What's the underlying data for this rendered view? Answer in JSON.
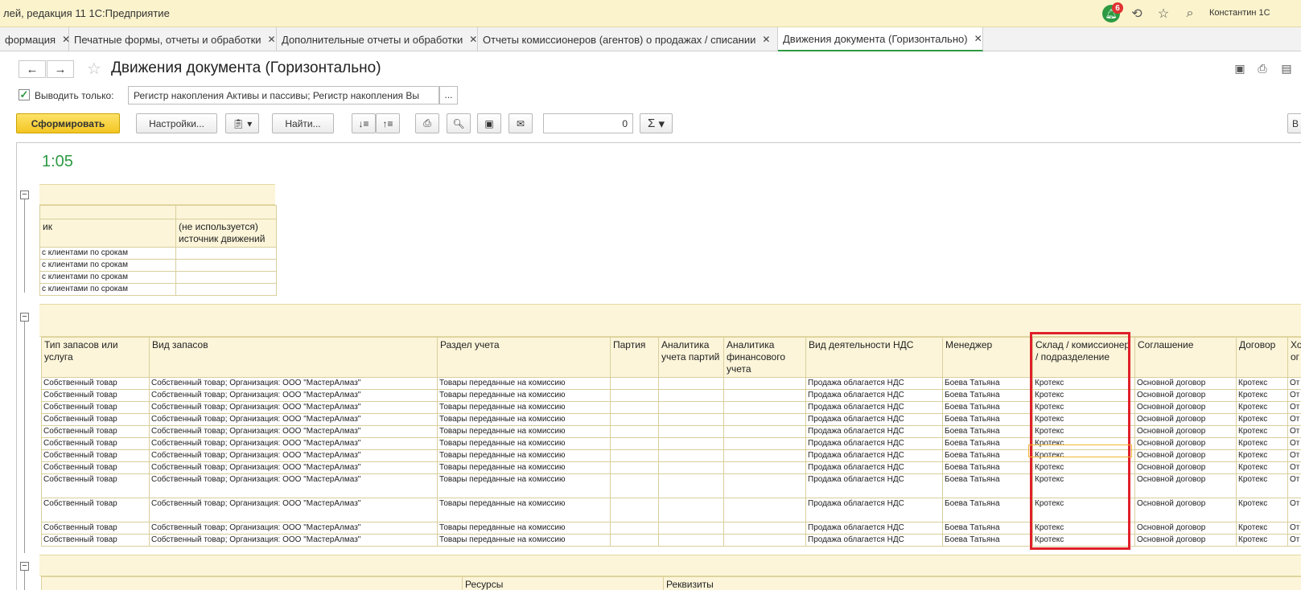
{
  "window": {
    "title": "лей, редакция 11 1С:Предприятие",
    "notifications": "6",
    "user": "Константин 1С",
    "icons": [
      "bell-icon",
      "history-icon",
      "star-icon",
      "search-icon"
    ]
  },
  "tabs": [
    {
      "label": "формация"
    },
    {
      "label": "Печатные формы, отчеты и обработки"
    },
    {
      "label": "Дополнительные отчеты и обработки"
    },
    {
      "label": "Отчеты комиссионеров (агентов) о продажах / списании"
    },
    {
      "label": "Движения документа (Горизонтально)"
    }
  ],
  "header": {
    "title": "Движения документа (Горизонтально)",
    "back": "←",
    "forward": "→"
  },
  "filter": {
    "checkbox_label": "Выводить только:",
    "checked": true,
    "value": "Регистр накопления Активы и пассивы; Регистр накопления Вы",
    "more": "..."
  },
  "toolbar": {
    "generate": "Сформировать",
    "settings": "Настройки...",
    "find": "Найти...",
    "sum_value": "0",
    "sigma": "Σ"
  },
  "report": {
    "time": "1:05",
    "section1": {
      "headers": [
        "ик",
        "(не используется) источник движений"
      ],
      "rows": [
        [
          "с клиентами по срокам",
          ""
        ],
        [
          "с клиентами по срокам",
          ""
        ],
        [
          "с клиентами по срокам",
          ""
        ],
        [
          "с клиентами по срокам",
          ""
        ]
      ]
    },
    "section2": {
      "headers": [
        "Тип запасов или услуга",
        "Вид запасов",
        "Раздел учета",
        "Партия",
        "Аналитика учета партий",
        "Аналитика финансового учета",
        "Вид деятельности НДС",
        "Менеджер",
        "Склад / комиссионер / подразделение",
        "Соглашение",
        "Договор",
        "Хо ог"
      ],
      "rows": [
        [
          "Собственный товар",
          "Собственный товар; Организация: ООО \"МастерАлмаз\"",
          "Товары переданные на комиссию",
          "",
          "",
          "",
          "Продажа облагается НДС",
          "Боева Татьяна",
          "Кротекс",
          "Основной договор",
          "Кротекс",
          "От"
        ],
        [
          "Собственный товар",
          "Собственный товар; Организация: ООО \"МастерАлмаз\"",
          "Товары переданные на комиссию",
          "",
          "",
          "",
          "Продажа облагается НДС",
          "Боева Татьяна",
          "Кротекс",
          "Основной договор",
          "Кротекс",
          "От"
        ],
        [
          "Собственный товар",
          "Собственный товар; Организация: ООО \"МастерАлмаз\"",
          "Товары переданные на комиссию",
          "",
          "",
          "",
          "Продажа облагается НДС",
          "Боева Татьяна",
          "Кротекс",
          "Основной договор",
          "Кротекс",
          "От"
        ],
        [
          "Собственный товар",
          "Собственный товар; Организация: ООО \"МастерАлмаз\"",
          "Товары переданные на комиссию",
          "",
          "",
          "",
          "Продажа облагается НДС",
          "Боева Татьяна",
          "Кротекс",
          "Основной договор",
          "Кротекс",
          "От"
        ],
        [
          "Собственный товар",
          "Собственный товар; Организация: ООО \"МастерАлмаз\"",
          "Товары переданные на комиссию",
          "",
          "",
          "",
          "Продажа облагается НДС",
          "Боева Татьяна",
          "Кротекс",
          "Основной договор",
          "Кротекс",
          "От"
        ],
        [
          "Собственный товар",
          "Собственный товар; Организация: ООО \"МастерАлмаз\"",
          "Товары переданные на комиссию",
          "",
          "",
          "",
          "Продажа облагается НДС",
          "Боева Татьяна",
          "Кротекс",
          "Основной договор",
          "Кротекс",
          "От"
        ],
        [
          "Собственный товар",
          "Собственный товар; Организация: ООО \"МастерАлмаз\"",
          "Товары переданные на комиссию",
          "",
          "",
          "",
          "Продажа облагается НДС",
          "Боева Татьяна",
          "Кротекс",
          "Основной договор",
          "Кротекс",
          "От"
        ],
        [
          "Собственный товар",
          "Собственный товар; Организация: ООО \"МастерАлмаз\"",
          "Товары переданные на комиссию",
          "",
          "",
          "",
          "Продажа облагается НДС",
          "Боева Татьяна",
          "Кротекс",
          "Основной договор",
          "Кротекс",
          "От"
        ],
        [
          "Собственный товар",
          "Собственный товар; Организация: ООО \"МастерАлмаз\"",
          "Товары переданные на комиссию",
          "",
          "",
          "",
          "Продажа облагается НДС",
          "Боева Татьяна",
          "Кротекс",
          "Основной договор",
          "Кротекс",
          "От"
        ],
        [
          "Собственный товар",
          "Собственный товар; Организация: ООО \"МастерАлмаз\"",
          "Товары переданные на комиссию",
          "",
          "",
          "",
          "Продажа облагается НДС",
          "Боева Татьяна",
          "Кротекс",
          "Основной договор",
          "Кротекс",
          "От"
        ],
        [
          "Собственный товар",
          "Собственный товар; Организация: ООО \"МастерАлмаз\"",
          "Товары переданные на комиссию",
          "",
          "",
          "",
          "Продажа облагается НДС",
          "Боева Татьяна",
          "Кротекс",
          "Основной договор",
          "Кротекс",
          "От"
        ],
        [
          "Собственный товар",
          "Собственный товар; Организация: ООО \"МастерАлмаз\"",
          "Товары переданные на комиссию",
          "",
          "",
          "",
          "Продажа облагается НДС",
          "Боева Татьяна",
          "Кротекс",
          "Основной договор",
          "Кротекс",
          "От"
        ]
      ]
    },
    "section3": {
      "resources": "Ресурсы",
      "attributes": "Реквизиты"
    }
  }
}
